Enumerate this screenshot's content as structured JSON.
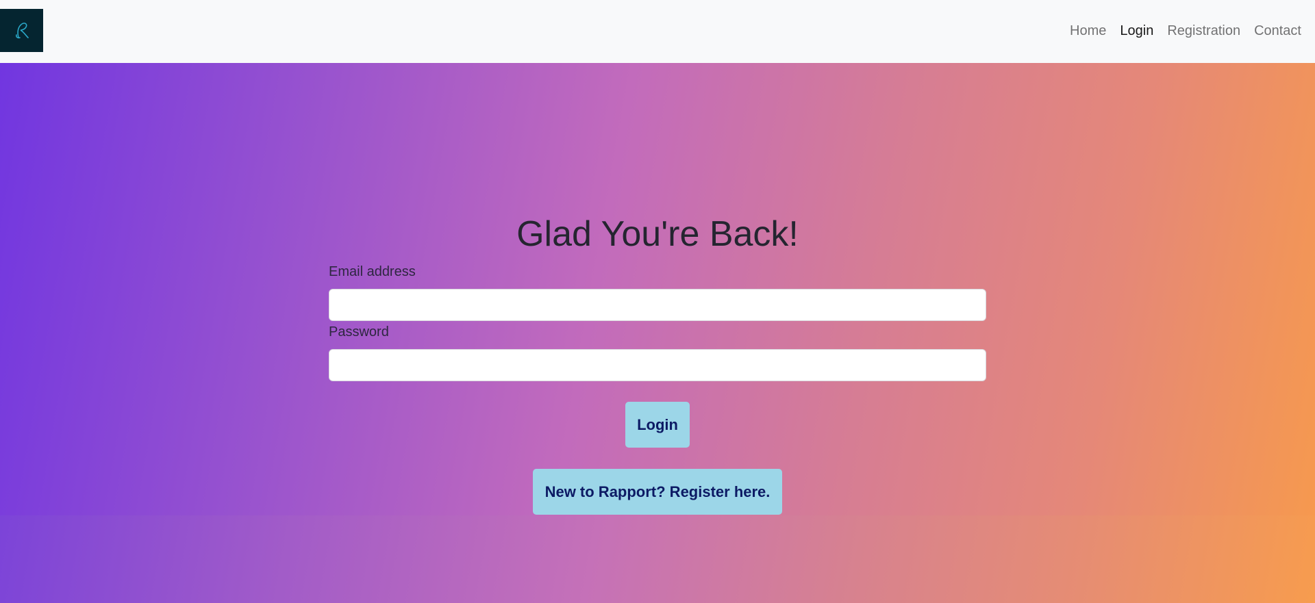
{
  "nav": {
    "brand_icon": "rapport-logo-icon",
    "links": [
      {
        "label": "Home"
      },
      {
        "label": "Login"
      },
      {
        "label": "Registration"
      },
      {
        "label": "Contact"
      }
    ]
  },
  "login": {
    "heading": "Glad You're Back!",
    "email_label": "Email address",
    "email_value": "",
    "password_label": "Password",
    "password_value": "",
    "login_button": "Login",
    "register_button": "New to Rapport? Register here."
  },
  "colors": {
    "gradient_start": "#7136e0",
    "gradient_mid": "#c26bbc",
    "gradient_end": "#f79a4c",
    "button_bg": "#9cd6e8",
    "button_text": "#0c1a64",
    "brand_bg": "#052530"
  }
}
